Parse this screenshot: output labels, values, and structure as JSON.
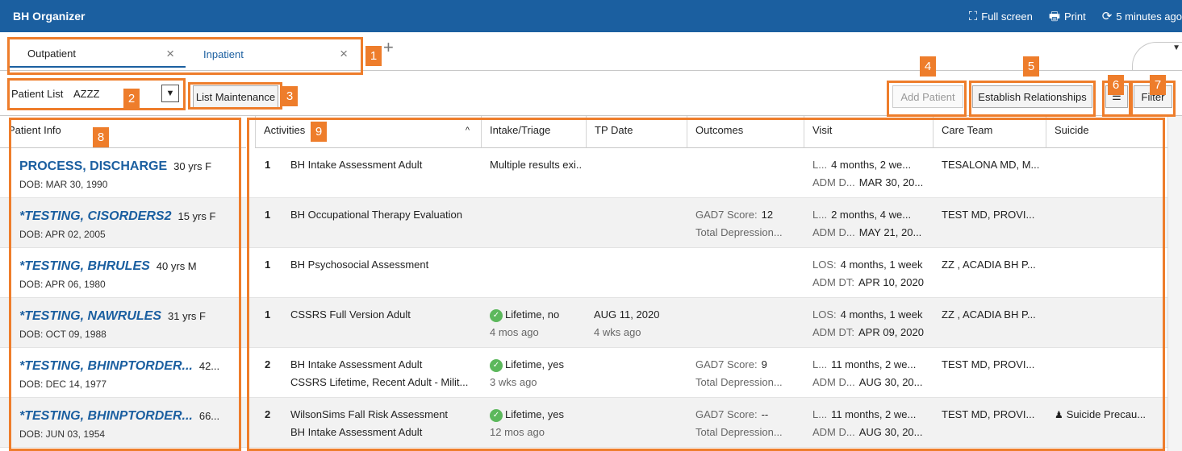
{
  "app": {
    "title": "BH Organizer",
    "actions": [
      {
        "label": "Full screen",
        "icon": "fullscreen-icon"
      },
      {
        "label": "Print",
        "icon": "printer-icon"
      },
      {
        "label": "5 minutes ago",
        "icon": "refresh-icon"
      }
    ]
  },
  "tabs": [
    {
      "label": "Outpatient",
      "active": true
    },
    {
      "label": "Inpatient",
      "active": false
    }
  ],
  "toolbar": {
    "patient_list_label": "Patient List",
    "patient_list_value": "AZZZ",
    "list_maintenance": "List Maintenance",
    "add_patient": "Add Patient",
    "establish_relationships": "Establish Relationships",
    "filter": "Filter"
  },
  "callouts": [
    "1",
    "2",
    "3",
    "4",
    "5",
    "6",
    "7",
    "8",
    "9"
  ],
  "columns": {
    "patient_info": "Patient Info",
    "activities": "Activities",
    "intake": "Intake/Triage",
    "tp_date": "TP Date",
    "outcomes": "Outcomes",
    "visit": "Visit",
    "care_team": "Care Team",
    "suicide": "Suicide"
  },
  "colors": {
    "brand": "#1b5fa0",
    "callout": "#ee7d2b",
    "success": "#5cb85c"
  },
  "patients": [
    {
      "name": "PROCESS, DISCHARGE",
      "test": false,
      "meta": "30 yrs  F",
      "dob": "DOB: MAR 30, 1990",
      "count": "1",
      "activities": [
        "BH Intake Assessment Adult"
      ],
      "intake": "Multiple results exi...",
      "intake_ok": false,
      "intake_time": "",
      "tp": "",
      "tp_ago": "",
      "outcome_l1": "",
      "outcome_v1": "",
      "outcome_l2": "",
      "visit_l1": "L...",
      "visit_v1": "4 months, 2 we...",
      "visit_l2": "ADM D...",
      "visit_v2": "MAR 30, 20...",
      "care": "TESALONA MD, M...",
      "suicide": "",
      "suicide_icon": false
    },
    {
      "name": "*TESTING, CISORDERS2",
      "test": true,
      "meta": "15 yrs  F",
      "dob": "DOB: APR 02, 2005",
      "count": "1",
      "activities": [
        "BH Occupational Therapy Evaluation"
      ],
      "intake": "",
      "intake_ok": false,
      "intake_time": "",
      "tp": "",
      "tp_ago": "",
      "outcome_l1": "GAD7 Score:",
      "outcome_v1": "12",
      "outcome_l2": "Total Depression...",
      "visit_l1": "L...",
      "visit_v1": "2 months, 4 we...",
      "visit_l2": "ADM D...",
      "visit_v2": "MAY 21, 20...",
      "care": "TEST MD, PROVI...",
      "suicide": "",
      "suicide_icon": false
    },
    {
      "name": "*TESTING, BHRULES",
      "test": true,
      "meta": "40 yrs  M",
      "dob": "DOB: APR 06, 1980",
      "count": "1",
      "activities": [
        "BH Psychosocial Assessment"
      ],
      "intake": "",
      "intake_ok": false,
      "intake_time": "",
      "tp": "",
      "tp_ago": "",
      "outcome_l1": "",
      "outcome_v1": "",
      "outcome_l2": "",
      "visit_l1": "LOS:",
      "visit_v1": "4 months, 1 week",
      "visit_l2": "ADM DT:",
      "visit_v2": "APR 10, 2020",
      "care": "ZZ , ACADIA BH P...",
      "suicide": "",
      "suicide_icon": false
    },
    {
      "name": "*TESTING, NAWRULES",
      "test": true,
      "meta": "31 yrs  F",
      "dob": "DOB: OCT 09, 1988",
      "count": "1",
      "activities": [
        "CSSRS Full Version Adult"
      ],
      "intake": "Lifetime, no",
      "intake_ok": true,
      "intake_time": "4 mos ago",
      "tp": "AUG 11, 2020",
      "tp_ago": "4 wks ago",
      "outcome_l1": "",
      "outcome_v1": "",
      "outcome_l2": "",
      "visit_l1": "LOS:",
      "visit_v1": "4 months, 1 week",
      "visit_l2": "ADM DT:",
      "visit_v2": "APR 09, 2020",
      "care": "ZZ , ACADIA BH P...",
      "suicide": "",
      "suicide_icon": false
    },
    {
      "name": "*TESTING, BHINPTORDER...",
      "test": true,
      "meta": "42...",
      "dob": "DOB: DEC 14, 1977",
      "count": "2",
      "activities": [
        "BH Intake Assessment Adult",
        "CSSRS Lifetime, Recent Adult - Milit..."
      ],
      "intake": "Lifetime, yes",
      "intake_ok": true,
      "intake_time": "3 wks ago",
      "tp": "",
      "tp_ago": "",
      "outcome_l1": "GAD7 Score:",
      "outcome_v1": "9",
      "outcome_l2": "Total Depression...",
      "visit_l1": "L...",
      "visit_v1": "11 months, 2 we...",
      "visit_l2": "ADM D...",
      "visit_v2": "AUG 30, 20...",
      "care": "TEST MD, PROVI...",
      "suicide": "",
      "suicide_icon": false
    },
    {
      "name": "*TESTING, BHINPTORDER...",
      "test": true,
      "meta": "66...",
      "dob": "DOB: JUN 03, 1954",
      "count": "2",
      "activities": [
        "WilsonSims Fall Risk Assessment",
        "BH Intake Assessment Adult"
      ],
      "intake": "Lifetime, yes",
      "intake_ok": true,
      "intake_time": "12 mos ago",
      "tp": "",
      "tp_ago": "",
      "outcome_l1": "GAD7 Score:",
      "outcome_v1": "--",
      "outcome_l2": "Total Depression...",
      "visit_l1": "L...",
      "visit_v1": "11 months, 2 we...",
      "visit_l2": "ADM D...",
      "visit_v2": "AUG 30, 20...",
      "care": "TEST MD, PROVI...",
      "suicide": "Suicide Precau...",
      "suicide_icon": true
    }
  ]
}
